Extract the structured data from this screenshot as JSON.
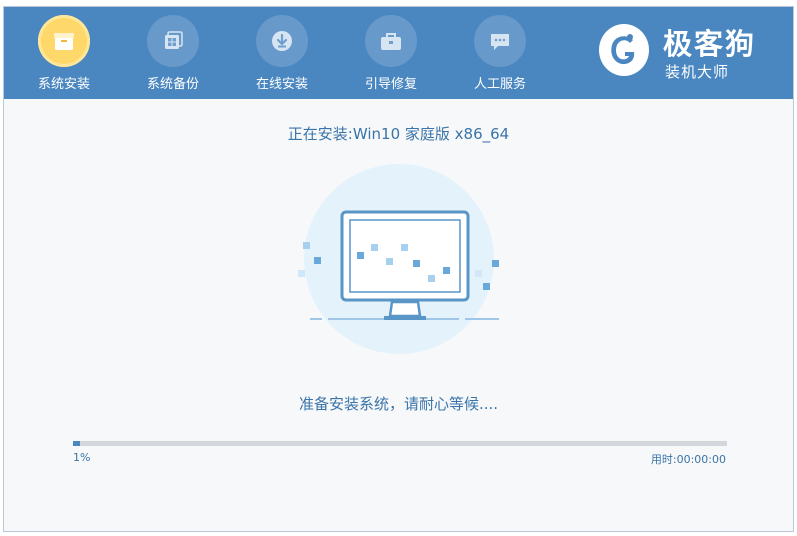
{
  "nav": {
    "tabs": [
      {
        "label": "系统安装",
        "icon": "package-icon",
        "active": true
      },
      {
        "label": "系统备份",
        "icon": "windows-backup-icon",
        "active": false
      },
      {
        "label": "在线安装",
        "icon": "download-icon",
        "active": false
      },
      {
        "label": "引导修复",
        "icon": "toolbox-icon",
        "active": false
      },
      {
        "label": "人工服务",
        "icon": "chat-bubble-icon",
        "active": false
      }
    ]
  },
  "brand": {
    "name": "极客狗",
    "subtitle": "装机大师",
    "logo": "g-dog-logo"
  },
  "main": {
    "title": "正在安装:Win10 家庭版 x86_64",
    "status": "准备安装系统，请耐心等候....",
    "illustration": "monitor-installing-illustration"
  },
  "progress": {
    "value_percent": 1,
    "label": "1%",
    "elapsed": "用时:00:00:00"
  },
  "colors": {
    "header": "#4a87c1",
    "accent_text": "#3a74a8",
    "active_tab": "#ffd86b"
  }
}
